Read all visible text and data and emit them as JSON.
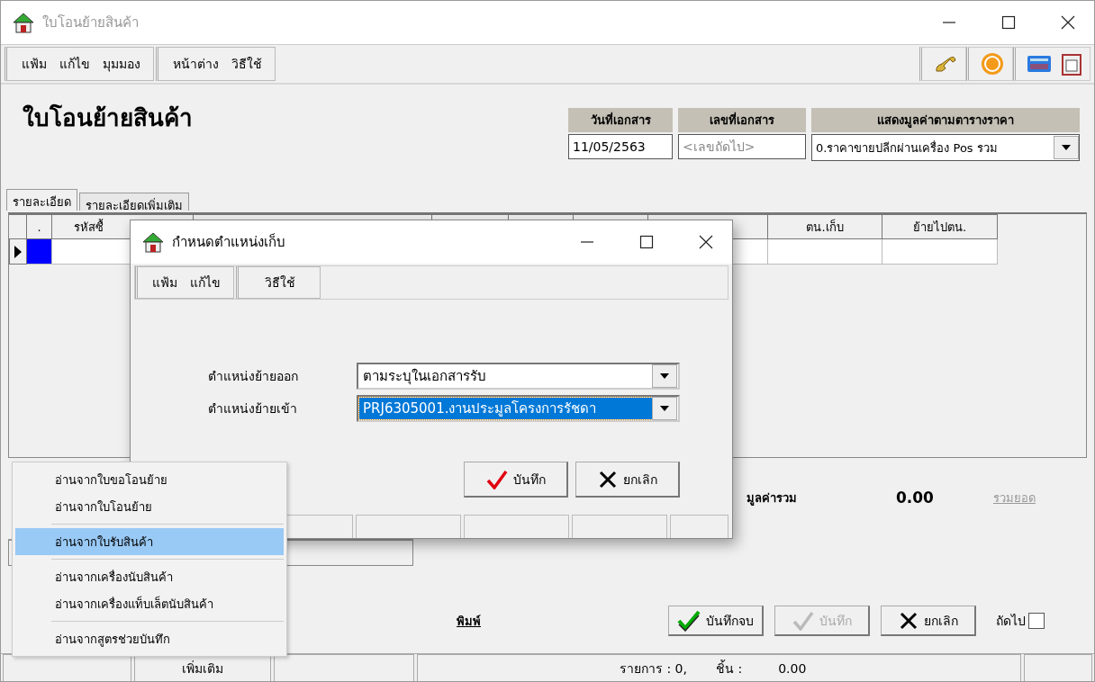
{
  "window": {
    "title": "ใบโอนย้ายสินค้า"
  },
  "menubar": [
    {
      "items": [
        "แฟ้ม",
        "แก้ไข",
        "มุมมอง"
      ]
    },
    {
      "items": [
        "หน้าต่าง",
        "วิธีใช้"
      ]
    }
  ],
  "heading": "ใบโอนย้ายสินค้า",
  "doc_fields": [
    {
      "label": "วันที่เอกสาร",
      "value": "11/05/2563",
      "kind": "text"
    },
    {
      "label": "เลขที่เอกสาร",
      "placeholder": "<เลขถัดไป>",
      "kind": "text"
    },
    {
      "label": "แสดงมูลค่าตามตารางราคา",
      "value": "0.ราคาขายปลีกผ่านเครื่อง Pos รวม",
      "kind": "select"
    }
  ],
  "tabs": [
    {
      "label": "รายละเอียด",
      "selected": true
    },
    {
      "label": "รายละเอียดเพิ่มเติม",
      "selected": false
    }
  ],
  "grid": {
    "columns": [
      {
        "label": "."
      },
      {
        "label": "รหัสซื้"
      },
      {
        "label": "ตน.เก็บ"
      },
      {
        "label": "ย้ายไปตน."
      }
    ],
    "rows": [
      {
        "current": true
      }
    ]
  },
  "footer": {
    "total_label": "มูลค่ารวม",
    "total_value": "0.00",
    "total_link": {
      "label": "รวมยอด",
      "disabled": true
    },
    "print_link": "พิมพ์",
    "buttons": [
      {
        "label": "บันทึกจบ",
        "kind": "finish",
        "disabled": false
      },
      {
        "label": "บันทึก",
        "kind": "save",
        "disabled": true
      },
      {
        "label": "ยกเลิก",
        "kind": "cancel",
        "disabled": false
      }
    ],
    "next_checkbox": {
      "label": "ถัดไป",
      "checked": false
    }
  },
  "status_bar": {
    "more_label": "เพิ่มเติม",
    "items_label": "รายการ : 0,",
    "pieces_label": "ชิ้น :",
    "pieces_value": "0.00"
  },
  "dialog": {
    "title": "กำหนดตำแหน่งเก็บ",
    "menubar": [
      {
        "items": [
          "แฟ้ม",
          "แก้ไข"
        ]
      },
      {
        "items": [
          "วิธีใช้"
        ]
      }
    ],
    "fields": [
      {
        "label": "ตำแหน่งย้ายออก",
        "value": "ตามระบุในเอกสารรับ",
        "selected": false
      },
      {
        "label": "ตำแหน่งย้ายเข้า",
        "value": "PRJ6305001.งานประมูลโครงการรัชดา",
        "selected": true
      }
    ],
    "buttons": [
      {
        "label": "บันทึก",
        "kind": "save",
        "disabled": false
      },
      {
        "label": "ยกเลิก",
        "kind": "cancel",
        "disabled": false
      }
    ]
  },
  "context_menu": {
    "groups": [
      {
        "items": [
          {
            "label": "อ่านจากใบขอโอนย้าย",
            "selected": false
          },
          {
            "label": "อ่านจากใบโอนย้าย",
            "selected": false
          }
        ]
      },
      {
        "items": [
          {
            "label": "อ่านจากใบรับสินค้า",
            "selected": true
          }
        ]
      },
      {
        "items": [
          {
            "label": "อ่านจากเครื่องนับสินค้า",
            "selected": false
          },
          {
            "label": "อ่านจากเครื่องแท็บเล็ตนับสินค้า",
            "selected": false
          }
        ]
      },
      {
        "items": [
          {
            "label": "อ่านจากสูตรช่วยบันทึก",
            "selected": false
          }
        ]
      }
    ]
  }
}
